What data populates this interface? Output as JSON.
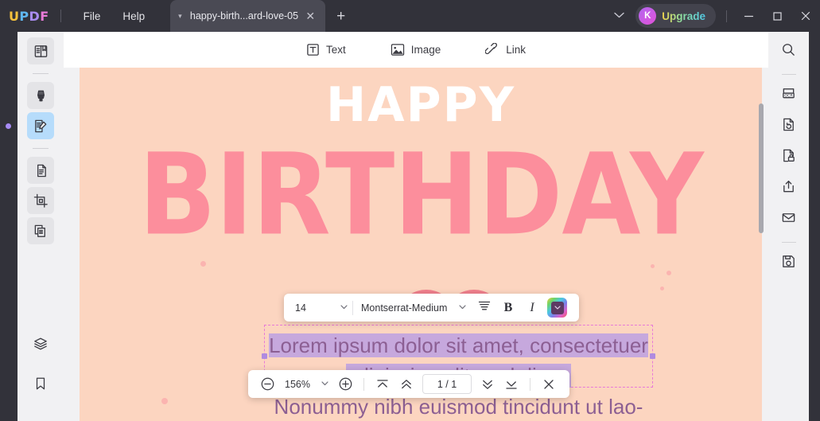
{
  "app": {
    "logo_letters": [
      "U",
      "P",
      "D",
      "F"
    ]
  },
  "titlebar": {
    "menu": [
      {
        "label": "File",
        "name": "menu-file"
      },
      {
        "label": "Help",
        "name": "menu-help"
      }
    ],
    "tab": {
      "title": "happy-birth...ard-love-05",
      "close_label": "✕",
      "caret": "▾"
    },
    "new_tab_label": "+",
    "tabs_chevron": "⌄",
    "upgrade": {
      "avatar_letter": "K",
      "label": "Upgrade"
    },
    "window_controls": {
      "minimize": "minimize",
      "maximize": "maximize",
      "close": "close"
    }
  },
  "left_sidebar": {
    "items": [
      {
        "name": "sidebar-item-reader",
        "icon": "book-reader-icon",
        "active": false
      },
      {
        "name": "sidebar-item-annotate",
        "icon": "highlighter-pen-icon",
        "active": false
      },
      {
        "name": "sidebar-item-edit-pdf",
        "icon": "edit-document-pen-icon",
        "active": true
      },
      {
        "name": "sidebar-item-organize-pages",
        "icon": "page-copy-icon",
        "active": false
      },
      {
        "name": "sidebar-item-crop",
        "icon": "crop-icon",
        "active": false
      },
      {
        "name": "sidebar-item-compare",
        "icon": "compare-pages-icon",
        "active": false
      }
    ],
    "bottom_items": [
      {
        "name": "sidebar-item-layers",
        "icon": "layers-icon"
      },
      {
        "name": "sidebar-item-bookmarks",
        "icon": "bookmark-icon"
      }
    ]
  },
  "right_sidebar": {
    "items": [
      {
        "name": "right-tool-search",
        "icon": "search-icon"
      },
      {
        "name": "right-tool-ocr",
        "icon": "ocr-icon"
      },
      {
        "name": "right-tool-convert",
        "icon": "convert-document-icon"
      },
      {
        "name": "right-tool-protect",
        "icon": "lock-document-icon"
      },
      {
        "name": "right-tool-share",
        "icon": "share-upload-icon"
      },
      {
        "name": "right-tool-email",
        "icon": "envelope-icon"
      },
      {
        "name": "right-tool-save",
        "icon": "save-disk-icon"
      }
    ]
  },
  "content_toolbar": {
    "items": [
      {
        "label": "Text",
        "name": "toolbar-text",
        "icon": "text-box-icon"
      },
      {
        "label": "Image",
        "name": "toolbar-image",
        "icon": "image-icon"
      },
      {
        "label": "Link",
        "name": "toolbar-link",
        "icon": "link-icon"
      }
    ]
  },
  "document": {
    "heading_small": "HAPPY",
    "heading_large": "BIRTHDAY",
    "body_line_1": "Lorem ipsum dolor sit amet, consectetuer",
    "body_line_2": "adipiscing elit, sed diam,",
    "body_line_3": "Nonummy nibh euismod tincidunt ut lao-",
    "colors": {
      "page_background": "#fcd5c0",
      "heading_large_color": "#fc8e9c",
      "heading_small_color": "#ffffff",
      "body_text_color": "#8c5f93",
      "selection_highlight": "#c6a8dd",
      "selection_border": "#e87ad8",
      "selection_handle": "#b08be0"
    }
  },
  "font_toolbar": {
    "font_size": "14",
    "font_size_caret": "▾",
    "font_family": "Montserrat-Medium",
    "font_family_caret": "▾",
    "align_name": "align-icon",
    "bold_label": "B",
    "italic_label": "I",
    "color_chip_caret": "▾",
    "color_chip_color": "#5d3a63"
  },
  "zoom_toolbar": {
    "zoom_out_label": "−",
    "zoom_level": "156%",
    "zoom_caret": "▾",
    "zoom_in_label": "+",
    "first_page_name": "first-page-icon",
    "prev_page_name": "previous-page-icon",
    "page_indicator": "1 / 1",
    "next_page_name": "next-page-icon",
    "last_page_name": "last-page-icon",
    "close_label": "✕"
  }
}
